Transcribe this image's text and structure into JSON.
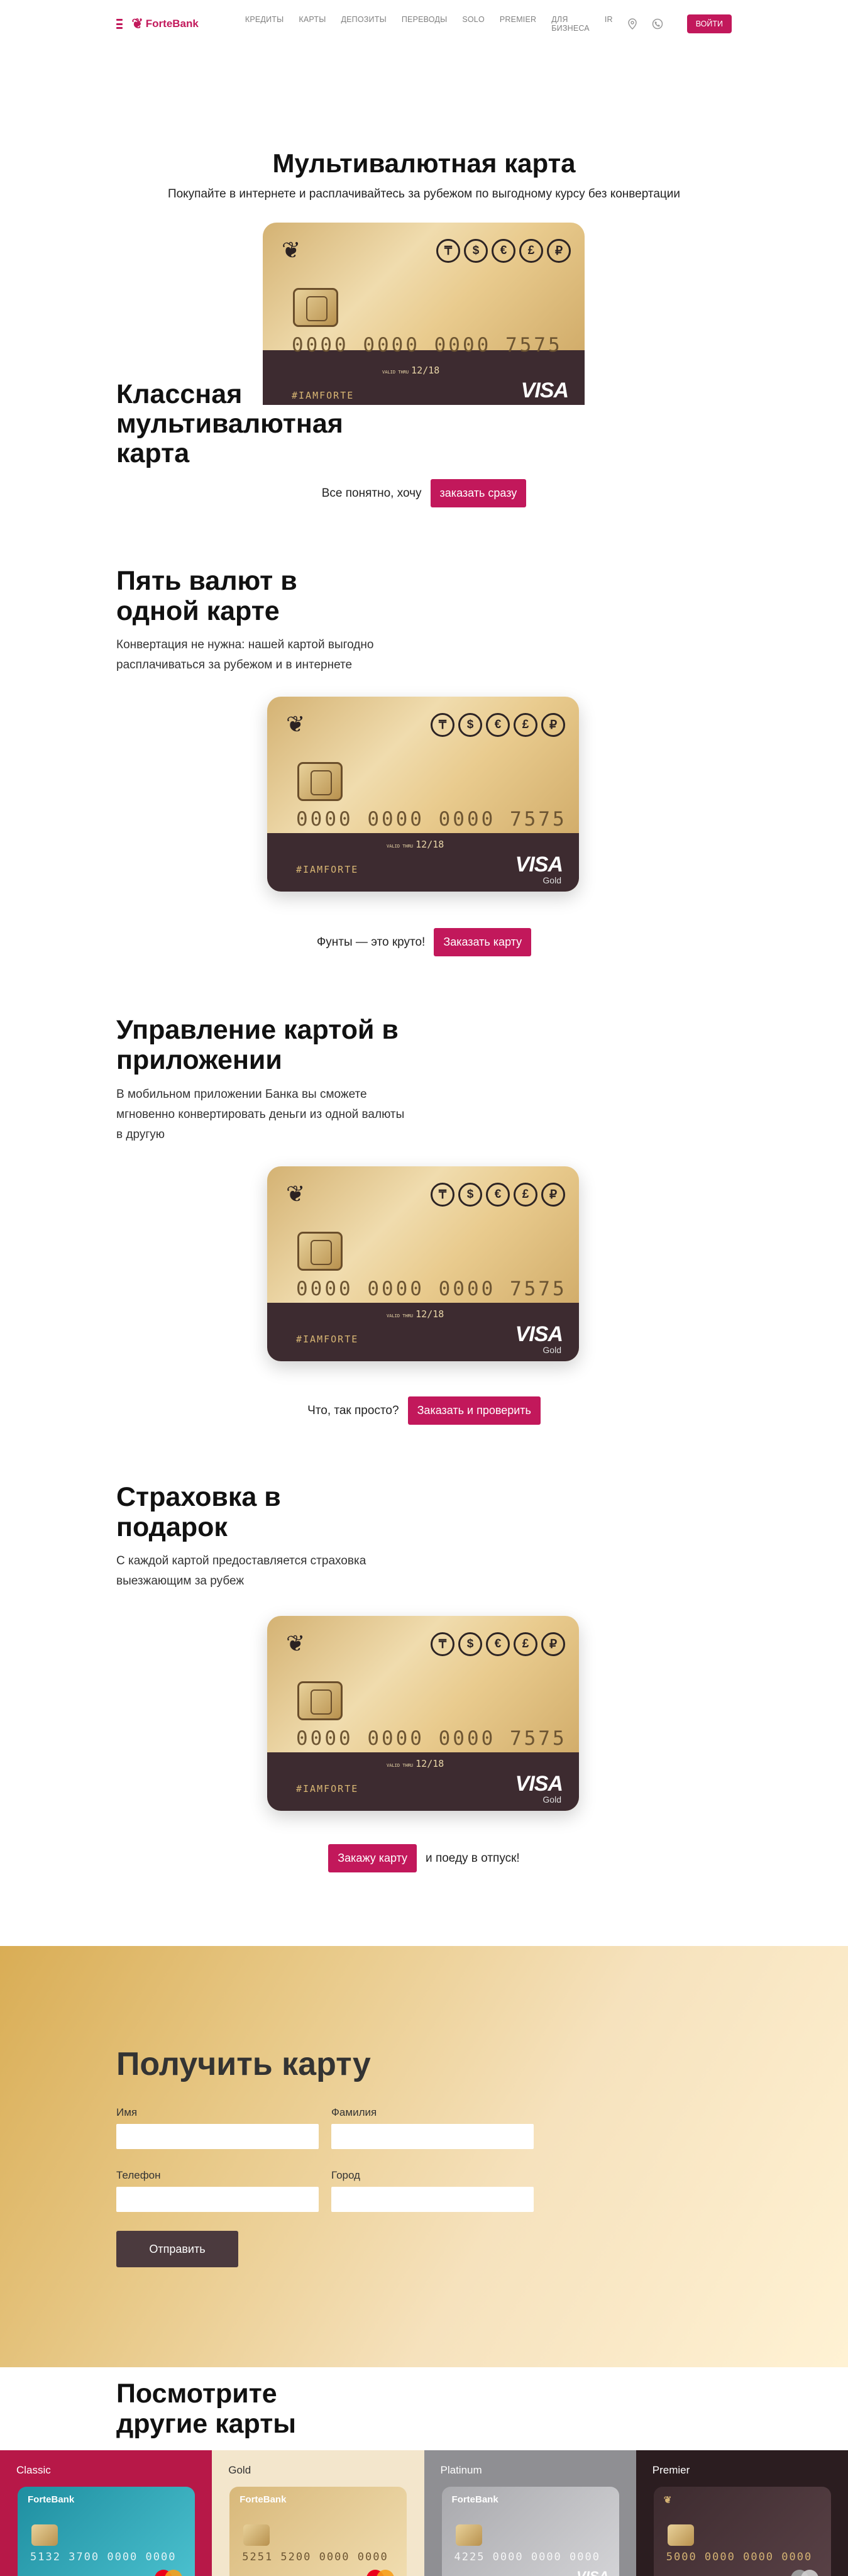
{
  "nav": {
    "logo": "ForteBank",
    "menu": [
      "КРЕДИТЫ",
      "КАРТЫ",
      "ДЕПОЗИТЫ",
      "ПЕРЕВОДЫ",
      "SOLO",
      "PREMIER",
      "ДЛЯ БИЗНЕСА",
      "IR"
    ],
    "login_label": "ВОЙТИ",
    "icons": [
      "menu-icon",
      "location-icon",
      "phone-icon"
    ],
    "accent_color": "#c2185b"
  },
  "hero": {
    "title": "Мультивалютная карта",
    "subtitle": "Покупайте в интернете и расплачивайтесь за рубежом по выгодному курсу без конвертации",
    "heading": "Классная мультивалютная карта",
    "cta_text": "Все понятно, хочу",
    "cta_button": "заказать сразу"
  },
  "card": {
    "currencies": [
      "₸",
      "$",
      "€",
      "£",
      "₽"
    ],
    "number": "0000 0000 0000 7575",
    "valid": "12/18",
    "valid_label": "VALID THRU",
    "holder": "#IAMFORTE",
    "brand": "VISA",
    "tier": "Gold"
  },
  "features": [
    {
      "title": "Пять валют в одной карте",
      "text": "Конвертация не нужна: нашей картой выгодно расплачиваться за рубежом и в интернете",
      "cta_text": "Фунты — это круто!",
      "cta_button": "Заказать карту"
    },
    {
      "title": "Управление картой в приложении",
      "text": "В мобильном приложении Банка вы сможете мгновенно конвертировать деньги из одной валюты в другую",
      "cta_text": "Что, так просто?",
      "cta_button": "Заказать и проверить"
    },
    {
      "title": "Страховка в подарок",
      "text": "С каждой картой предоставляется страховка выезжающим за рубеж",
      "cta_button": "Закажу карту",
      "cta_text": "и поеду в отпуск!"
    }
  ],
  "form": {
    "title": "Получить карту",
    "first_name_label": "Имя",
    "last_name_label": "Фамилия",
    "phone_label": "Телефон",
    "city_label": "Город",
    "submit_label": "Отправить"
  },
  "other_cards": {
    "title": "Посмотрите другие карты",
    "items": [
      {
        "label": "Classic",
        "number": "5132 3700 0000 0000",
        "brand": "Mastercard",
        "bg": "#b71848",
        "card_bg": "#2aa6b8"
      },
      {
        "label": "Gold",
        "number": "5251 5200 0000 0000",
        "brand": "Mastercard",
        "bg": "#f3e6cc",
        "card_bg": "#e3c892"
      },
      {
        "label": "Platinum",
        "number": "4225 0000 0000 0000",
        "brand": "VISA",
        "bg": "#8f8f93",
        "card_bg": "#bdbdc1"
      },
      {
        "label": "Premier",
        "number": "5000 0000 0000 0000",
        "brand": "Mastercard",
        "bg": "#2b1d20",
        "card_bg": "#3d2b2f"
      }
    ]
  }
}
